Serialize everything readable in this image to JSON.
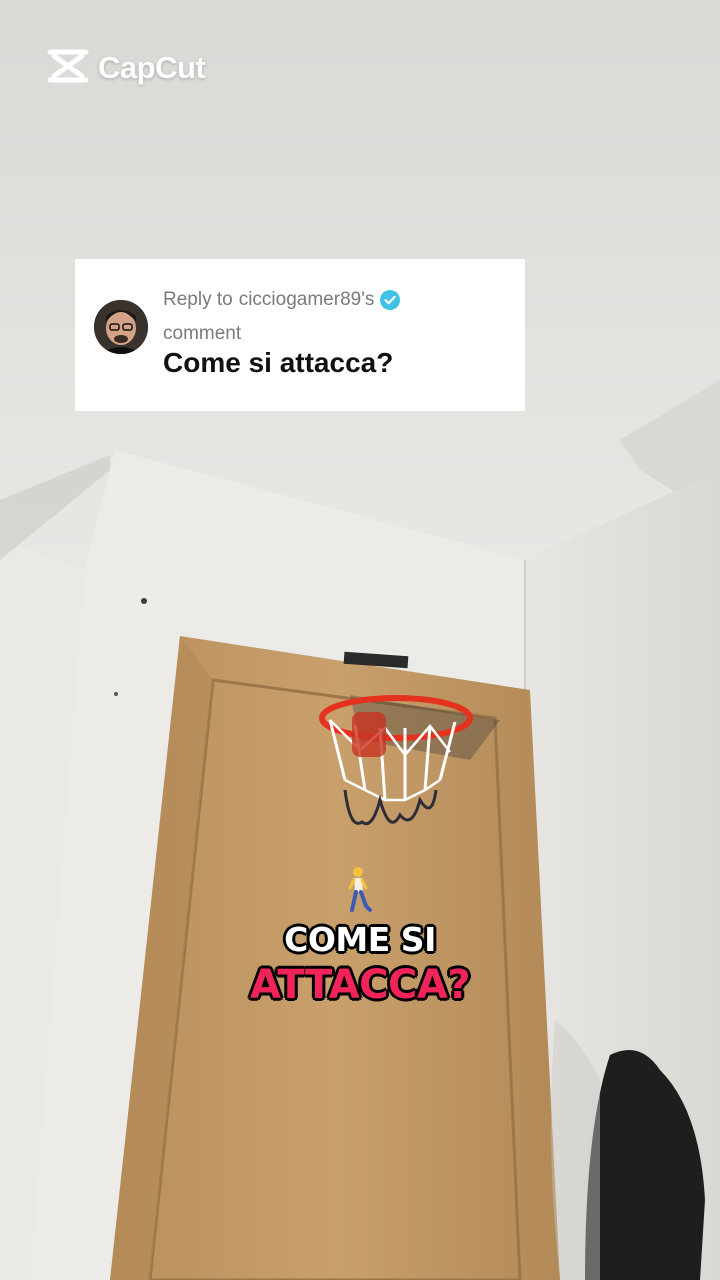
{
  "watermark": {
    "brand": "CapCut",
    "icon": "capcut-logo-icon"
  },
  "reply_card": {
    "prefix": "Reply to",
    "username": "cicciogamer89",
    "possessive": "'s",
    "suffix": "comment",
    "question": "Come si attacca?",
    "verified_icon": "verified-badge-icon",
    "verified_color": "#3fc2e6",
    "avatar_icon": "user-avatar"
  },
  "emoji": {
    "icon": "person-walking-icon"
  },
  "caption": {
    "line1": "COME SI",
    "line2": "ATTACCA?",
    "accent_color": "#f1245a"
  }
}
